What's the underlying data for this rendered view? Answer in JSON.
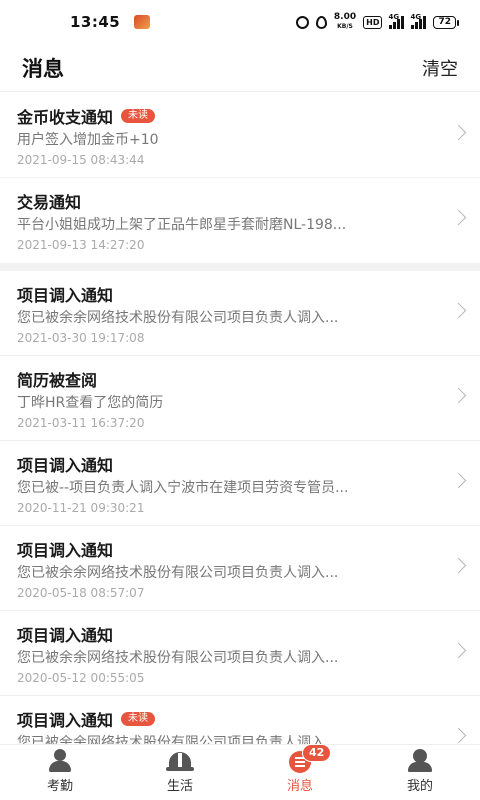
{
  "status_bar": {
    "time": "13:45",
    "speed_value": "8.00",
    "speed_unit": "KB/S",
    "hd_label": "HD",
    "sim1_label": "4G",
    "sim2_label": "4G",
    "battery": "72"
  },
  "header": {
    "title": "消息",
    "clear_label": "清空"
  },
  "messages": [
    {
      "title": "金币收支通知",
      "badge": "未读",
      "body": "用户签入增加金币+10",
      "time": "2021-09-15 08:43:44"
    },
    {
      "title": "交易通知",
      "badge": "",
      "body": "平台小姐姐成功上架了正品牛郎星手套耐磨NL-198...",
      "time": "2021-09-13 14:27:20"
    },
    {
      "title": "项目调入通知",
      "badge": "",
      "body": "您已被余余网络技术股份有限公司项目负责人调入...",
      "time": "2021-03-30 19:17:08"
    },
    {
      "title": "简历被查阅",
      "badge": "",
      "body": "丁晔HR查看了您的简历",
      "time": "2021-03-11 16:37:20"
    },
    {
      "title": "项目调入通知",
      "badge": "",
      "body": "您已被--项目负责人调入宁波市在建项目劳资专管员...",
      "time": "2020-11-21 09:30:21"
    },
    {
      "title": "项目调入通知",
      "badge": "",
      "body": "您已被余余网络技术股份有限公司项目负责人调入...",
      "time": "2020-05-18 08:57:07"
    },
    {
      "title": "项目调入通知",
      "badge": "",
      "body": "您已被余余网络技术股份有限公司项目负责人调入...",
      "time": "2020-05-12 00:55:05"
    },
    {
      "title": "项目调入通知",
      "badge": "未读",
      "body": "您已被余余网络技术股份有限公司项目负责人调入...",
      "time": ""
    }
  ],
  "tabbar": {
    "tabs": [
      {
        "label": "考勤",
        "icon": "person-icon"
      },
      {
        "label": "生活",
        "icon": "helmet-icon"
      },
      {
        "label": "消息",
        "icon": "message-icon",
        "count": "42"
      },
      {
        "label": "我的",
        "icon": "profile-icon"
      }
    ],
    "active_color": "#e8553e"
  }
}
